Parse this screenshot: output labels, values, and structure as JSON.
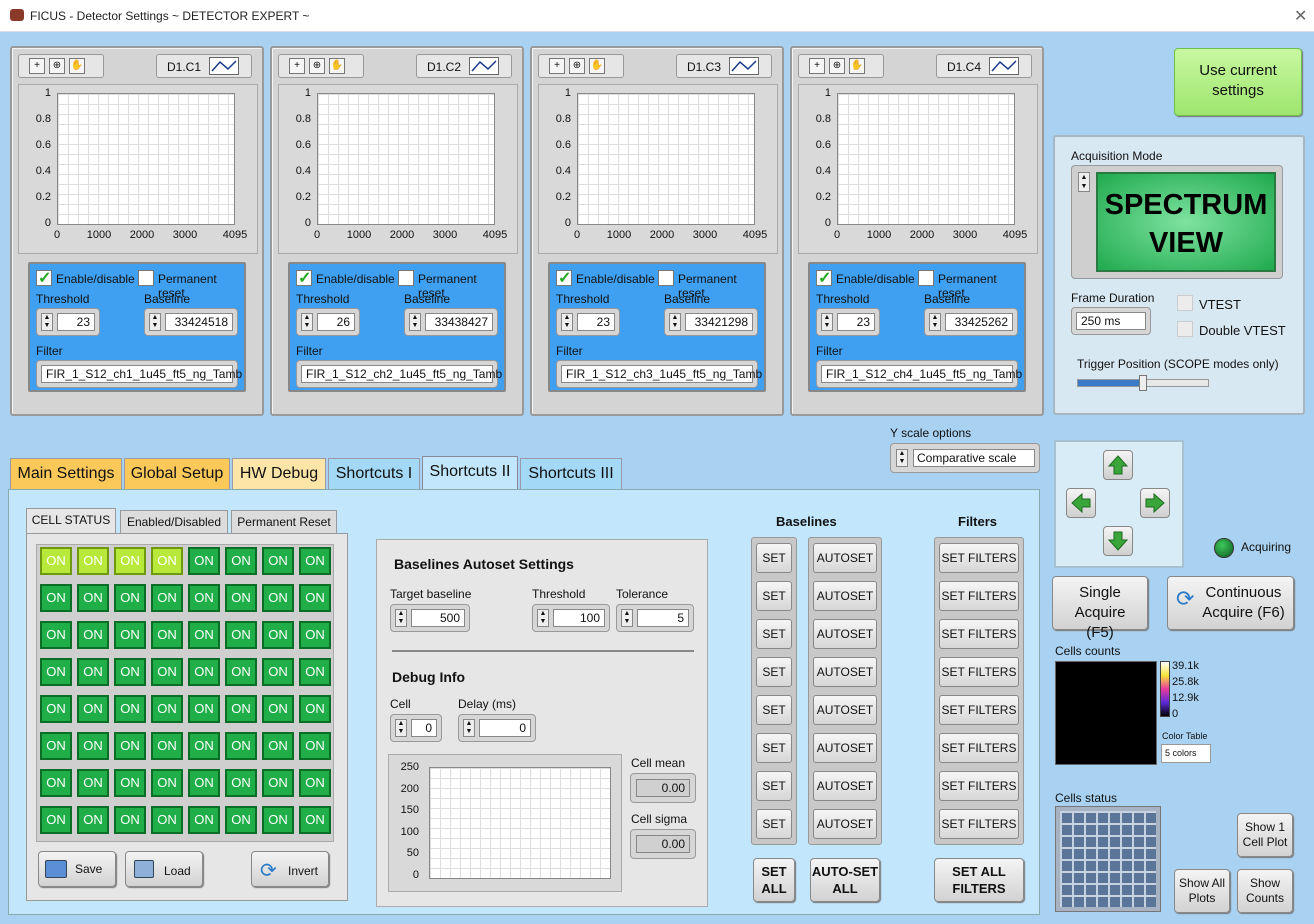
{
  "window": {
    "title": "FICUS - Detector Settings ~ DETECTOR EXPERT ~",
    "close_glyph": "✕"
  },
  "plot_axis": {
    "y_ticks": [
      "1",
      "0.8",
      "0.6",
      "0.4",
      "0.2",
      "0"
    ],
    "x_ticks": [
      "0",
      "1000",
      "2000",
      "3000",
      "4095"
    ]
  },
  "labels": {
    "enable": "Enable/disable",
    "permanent_reset": "Permanent reset",
    "threshold": "Threshold",
    "baseline": "Baseline",
    "filter": "Filter"
  },
  "channels": [
    {
      "name": "D1.C1",
      "enabled": true,
      "permanent_reset": false,
      "threshold": "23",
      "baseline": "33424518",
      "filter": "FIR_1_S12_ch1_1u45_ft5_ng_Tamb"
    },
    {
      "name": "D1.C2",
      "enabled": true,
      "permanent_reset": false,
      "threshold": "26",
      "baseline": "33438427",
      "filter": "FIR_1_S12_ch2_1u45_ft5_ng_Tamb"
    },
    {
      "name": "D1.C3",
      "enabled": true,
      "permanent_reset": false,
      "threshold": "23",
      "baseline": "33421298",
      "filter": "FIR_1_S12_ch3_1u45_ft5_ng_Tamb"
    },
    {
      "name": "D1.C4",
      "enabled": true,
      "permanent_reset": false,
      "threshold": "23",
      "baseline": "33425262",
      "filter": "FIR_1_S12_ch4_1u45_ft5_ng_Tamb"
    }
  ],
  "use_current": "Use current settings",
  "acquisition": {
    "mode_label": "Acquisition Mode",
    "mode_line1": "SPECTRUM",
    "mode_line2": "VIEW",
    "frame_label": "Frame Duration",
    "frame_value": "250 ms",
    "vtest": "VTEST",
    "double_vtest": "Double VTEST",
    "trigger_label": "Trigger Position (SCOPE modes only)",
    "trigger_level": 0.5
  },
  "yscale": {
    "label": "Y scale options",
    "value": "Comparative scale"
  },
  "tabs": [
    "Main Settings",
    "Global Setup",
    "HW Debug",
    "Shortcuts I",
    "Shortcuts II",
    "Shortcuts III"
  ],
  "subtabs": [
    "CELL STATUS",
    "Enabled/Disabled",
    "Permanent Reset"
  ],
  "cells": [
    [
      "ON",
      "ON",
      "ON",
      "ON",
      "ON",
      "ON",
      "ON",
      "ON"
    ],
    [
      "ON",
      "ON",
      "ON",
      "ON",
      "ON",
      "ON",
      "ON",
      "ON"
    ],
    [
      "ON",
      "ON",
      "ON",
      "ON",
      "ON",
      "ON",
      "ON",
      "ON"
    ],
    [
      "ON",
      "ON",
      "ON",
      "ON",
      "ON",
      "ON",
      "ON",
      "ON"
    ],
    [
      "ON",
      "ON",
      "ON",
      "ON",
      "ON",
      "ON",
      "ON",
      "ON"
    ],
    [
      "ON",
      "ON",
      "ON",
      "ON",
      "ON",
      "ON",
      "ON",
      "ON"
    ],
    [
      "ON",
      "ON",
      "ON",
      "ON",
      "ON",
      "ON",
      "ON",
      "ON"
    ],
    [
      "ON",
      "ON",
      "ON",
      "ON",
      "ON",
      "ON",
      "ON",
      "ON"
    ]
  ],
  "cell_buttons": {
    "save": "Save",
    "load": "Load",
    "invert": "Invert"
  },
  "autoset": {
    "title": "Baselines Autoset Settings",
    "target_label": "Target baseline",
    "target_value": "500",
    "threshold_label": "Threshold",
    "threshold_value": "100",
    "tolerance_label": "Tolerance",
    "tolerance_value": "5"
  },
  "debug": {
    "title": "Debug Info",
    "cell_label": "Cell",
    "cell_value": "0",
    "delay_label": "Delay (ms)",
    "delay_value": "0",
    "mean_label": "Cell mean",
    "mean_value": "0.00",
    "sigma_label": "Cell sigma",
    "sigma_value": "0.00",
    "y_ticks": [
      "250",
      "200",
      "150",
      "100",
      "50",
      "0"
    ]
  },
  "baselines_header": "Baselines",
  "filters_header": "Filters",
  "set_label": "SET",
  "autoset_label": "AUTOSET",
  "setfilters_label": "SET FILTERS",
  "set_all": "SET ALL",
  "autoset_all": "AUTO-SET ALL",
  "set_all_filters": "SET ALL FILTERS",
  "acquiring": "Acquiring",
  "single": "Single Acquire (F5)",
  "continuous": "Continuous Acquire (F6)",
  "cells_counts": {
    "label": "Cells counts",
    "scale": [
      "39.1k",
      "25.8k",
      "12.9k",
      "0"
    ],
    "color_table_label": "Color Table",
    "color_table_value": "5 colors"
  },
  "cells_status_label": "Cells status",
  "show1": "Show 1 Cell Plot",
  "show_all": "Show All Plots",
  "show_counts": "Show Counts",
  "colors": {
    "background": "#a9d2f2",
    "cell_on": "#1fae48",
    "cell_yellow": "#b8e83a",
    "mode_green": "#22b85a",
    "use_current": "#b6f28a"
  }
}
